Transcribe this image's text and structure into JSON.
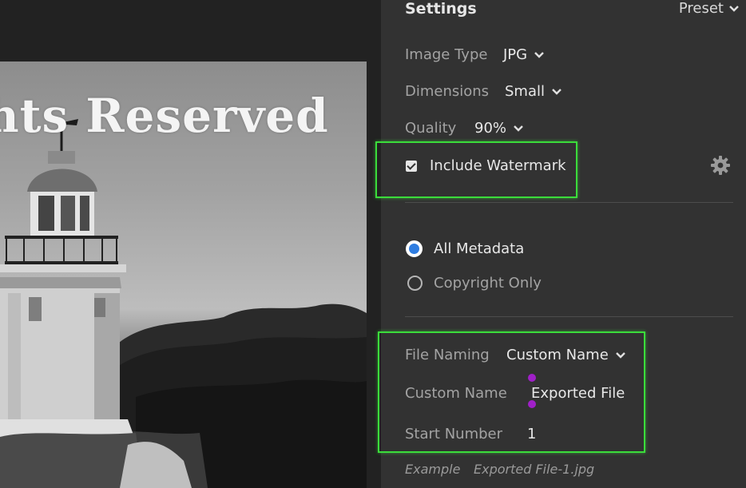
{
  "preview": {
    "watermark_text": "ghts Reserved"
  },
  "settings": {
    "title": "Settings",
    "preset_label": "Preset",
    "image_type": {
      "label": "Image Type",
      "value": "JPG"
    },
    "dimensions": {
      "label": "Dimensions",
      "value": "Small"
    },
    "quality": {
      "label": "Quality",
      "value": "90%"
    },
    "include_watermark": {
      "label": "Include Watermark",
      "checked": true
    },
    "metadata": {
      "options": [
        "All Metadata",
        "Copyright Only"
      ],
      "selected": "All Metadata"
    },
    "file_naming": {
      "label": "File Naming",
      "value": "Custom Name"
    },
    "custom_name": {
      "label": "Custom Name",
      "value": "Exported File"
    },
    "start_number": {
      "label": "Start Number",
      "value": "1"
    },
    "example": {
      "label": "Example",
      "value": "Exported File-1.jpg"
    }
  },
  "colors": {
    "accent": "#2f7de1",
    "highlight": "#3bdc3b",
    "panel_bg": "#323232",
    "caret": "#a020c8"
  }
}
